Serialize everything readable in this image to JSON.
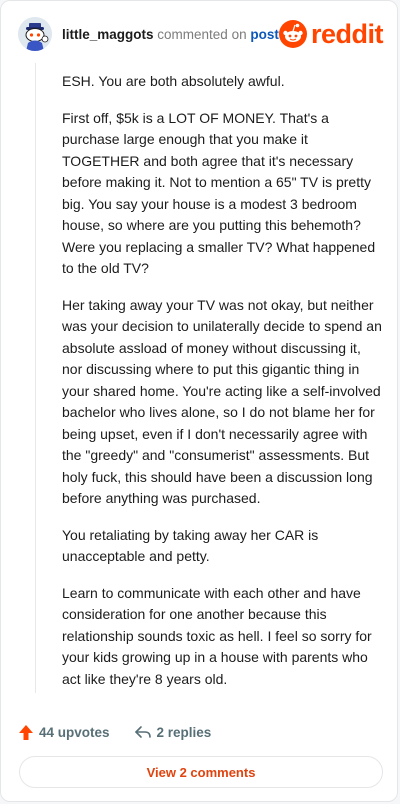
{
  "header": {
    "username": "little_maggots",
    "commented_on": "commented on",
    "post_link": "post",
    "brand": "reddit"
  },
  "comment": {
    "paragraphs": [
      "ESH. You are both absolutely awful.",
      "First off, $5k is a LOT OF MONEY. That's a purchase large enough that you make it TOGETHER and both agree that it's necessary before making it. Not to mention a 65\" TV is pretty big. You say your house is a modest 3 bedroom house, so where are you putting this behemoth? Were you replacing a smaller TV? What happened to the old TV?",
      "Her taking away your TV was not okay, but neither was your decision to unilaterally decide to spend an absolute assload of money without discussing it, nor discussing where to put this gigantic thing in your shared home. You're acting like a self-involved bachelor who lives alone, so I do not blame her for being upset, even if I don't necessarily agree with the \"greedy\" and \"consumerist\" assessments. But holy fuck, this should have been a discussion long before anything was purchased.",
      "You retaliating by taking away her CAR is unacceptable and petty.",
      "Learn to communicate with each other and have consideration for one another because this relationship sounds toxic as hell. I feel so sorry for your kids growing up in a house with parents who act like they're 8 years old."
    ]
  },
  "actions": {
    "upvotes": "44 upvotes",
    "replies": "2 replies",
    "view_comments": "View 2 comments"
  },
  "colors": {
    "accent": "#ff4500",
    "link": "#0d57b9",
    "muted": "#576f76"
  },
  "icons": {
    "avatar": "snoo-avatar",
    "brand": "reddit-logo-icon",
    "upvote": "upvote-arrow-icon",
    "reply": "reply-arrow-icon"
  }
}
